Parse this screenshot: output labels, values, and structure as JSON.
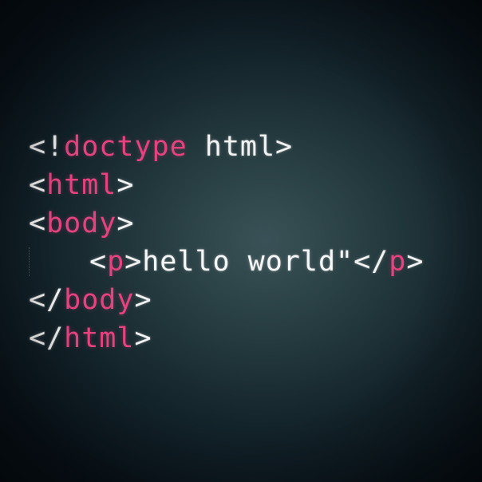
{
  "colors": {
    "background": "#1c3034",
    "tag": "#e4437f",
    "text": "#f2f2f2"
  },
  "code": {
    "line1": {
      "open": "<!",
      "keyword": "doctype",
      "rest": " html>"
    },
    "line2": {
      "open": "<",
      "tag": "html",
      "close": ">"
    },
    "line3": {
      "open": "<",
      "tag": "body",
      "close": ">"
    },
    "line4": {
      "open": "<",
      "tag": "p",
      "close": ">",
      "content": "hello world\"",
      "end_open": "</",
      "end_tag": "p",
      "end_close": ">"
    },
    "line5": {
      "open": "</",
      "tag": "body",
      "close": ">"
    },
    "line6": {
      "open": "</",
      "tag": "html",
      "close": ">"
    }
  }
}
